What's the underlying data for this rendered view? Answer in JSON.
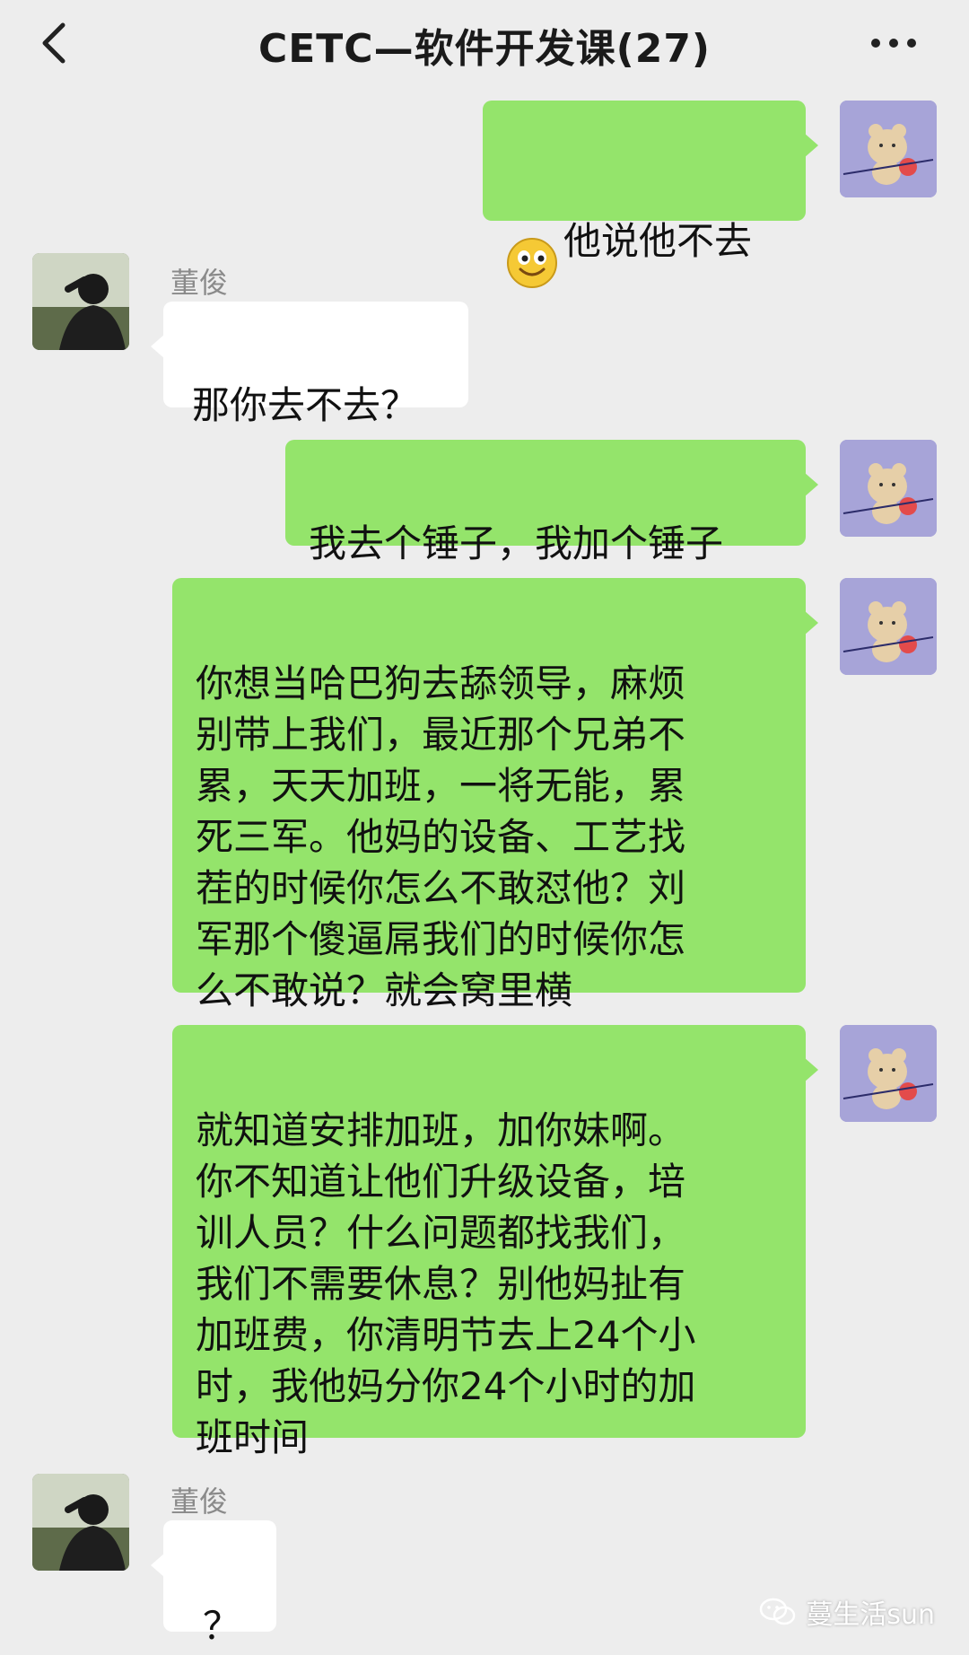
{
  "header": {
    "title": "CETC—软件开发课(27)",
    "back_icon": "chevron-left-icon",
    "more_icon": "more-dots-icon"
  },
  "messages": [
    {
      "from": "me",
      "text": "他说他不去",
      "emoji": "smiling-face-emoji"
    },
    {
      "from": "other",
      "sender": "董俊",
      "text": "那你去不去？"
    },
    {
      "from": "me",
      "text": "我去个锤子，我加个锤子"
    },
    {
      "from": "me",
      "text": "你想当哈巴狗去舔领导，麻烦\n别带上我们，最近那个兄弟不\n累，天天加班，一将无能，累\n死三军。他妈的设备、工艺找\n茬的时候你怎么不敢怼他？刘\n军那个傻逼屌我们的时候你怎\n么不敢说？就会窝里横"
    },
    {
      "from": "me",
      "text": "就知道安排加班，加你妹啊。\n你不知道让他们升级设备，培\n训人员？什么问题都找我们，\n我们不需要休息？别他妈扯有\n加班费，你清明节去上24个小\n时，我他妈分你24个小时的加\n班时间"
    },
    {
      "from": "other",
      "sender": "董俊",
      "text": "？"
    }
  ],
  "watermark": {
    "icon": "wechat-icon",
    "text": "蔓生活sun"
  },
  "colors": {
    "background": "#ededed",
    "outgoing_bubble": "#94e46b",
    "incoming_bubble": "#ffffff",
    "my_avatar": "#a7a4d8"
  }
}
